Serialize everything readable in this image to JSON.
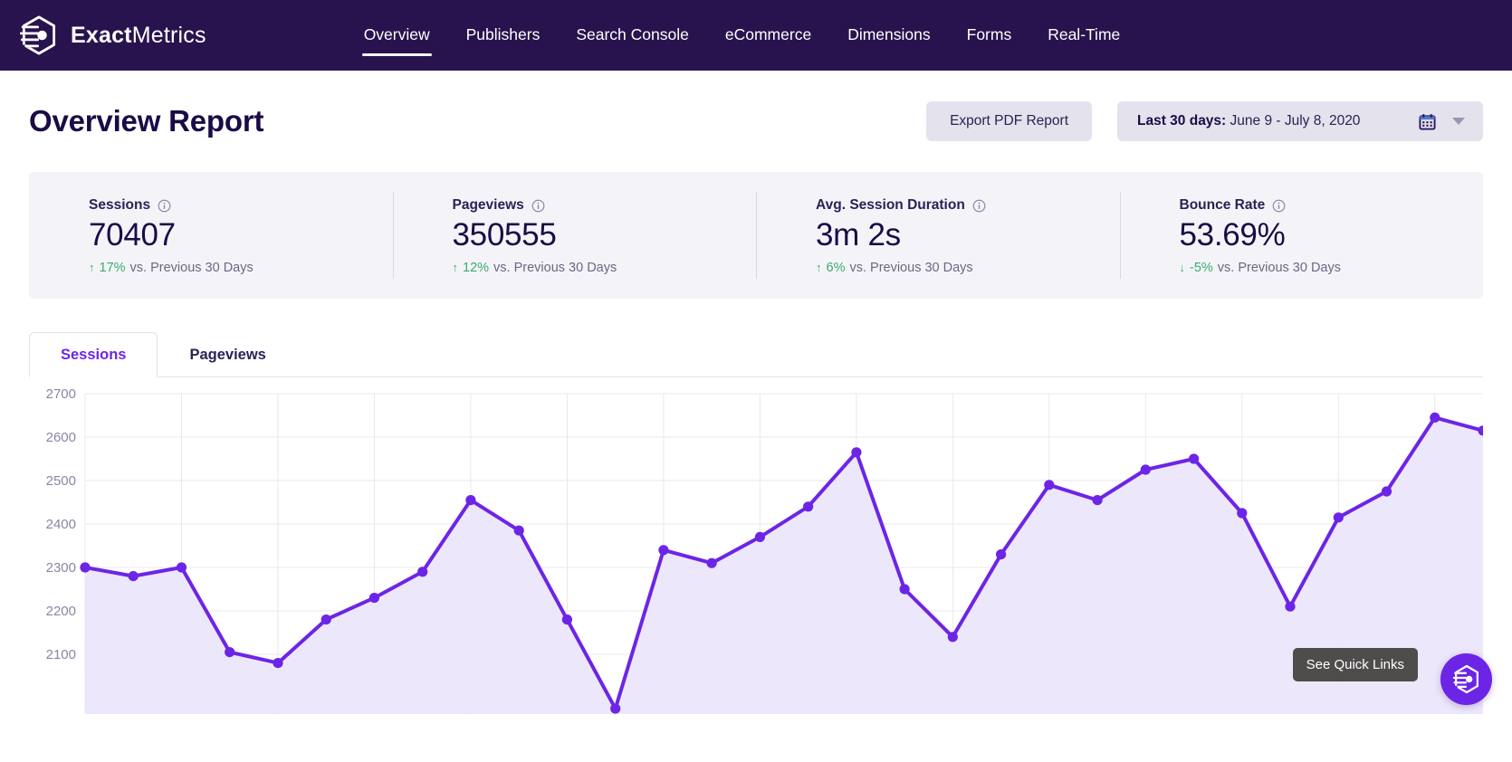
{
  "brand": {
    "bold": "Exact",
    "regular": "Metrics",
    "logo_icon": "exactmetrics-hexagon-logo"
  },
  "nav": {
    "items": [
      {
        "label": "Overview",
        "active": true
      },
      {
        "label": "Publishers",
        "active": false
      },
      {
        "label": "Search Console",
        "active": false
      },
      {
        "label": "eCommerce",
        "active": false
      },
      {
        "label": "Dimensions",
        "active": false
      },
      {
        "label": "Forms",
        "active": false
      },
      {
        "label": "Real-Time",
        "active": false
      }
    ]
  },
  "header": {
    "title": "Overview Report",
    "export_label": "Export PDF Report",
    "date_range_prefix": "Last 30 days:",
    "date_range_value": "June 9 - July 8, 2020",
    "calendar_icon": "calendar-icon",
    "caret_icon": "chevron-down-icon"
  },
  "stats": [
    {
      "label": "Sessions",
      "value": "70407",
      "delta_arrow": "↑",
      "delta": "17%",
      "note": "vs. Previous 30 Days",
      "direction": "up",
      "color": "#3aab72"
    },
    {
      "label": "Pageviews",
      "value": "350555",
      "delta_arrow": "↑",
      "delta": "12%",
      "note": "vs. Previous 30 Days",
      "direction": "up",
      "color": "#3aab72"
    },
    {
      "label": "Avg. Session Duration",
      "value": "3m 2s",
      "delta_arrow": "↑",
      "delta": "6%",
      "note": "vs. Previous 30 Days",
      "direction": "up",
      "color": "#3aab72"
    },
    {
      "label": "Bounce Rate",
      "value": "53.69%",
      "delta_arrow": "↓",
      "delta": "-5%",
      "note": "vs. Previous 30 Days",
      "direction": "down",
      "color": "#3aab72"
    }
  ],
  "tabs": [
    {
      "label": "Sessions",
      "active": true
    },
    {
      "label": "Pageviews",
      "active": false
    }
  ],
  "overlay": {
    "quick_links_tooltip": "See Quick Links",
    "fab_icon": "exactmetrics-hexagon-logo"
  },
  "colors": {
    "brand_dark": "#29134e",
    "accent_purple": "#6c25e6",
    "area_fill": "#ece6fb",
    "stat_strip": "#f4f4f8",
    "positive": "#3aab72"
  },
  "chart_data": {
    "type": "line",
    "title": "Sessions",
    "xlabel": "",
    "ylabel": "",
    "ylim": [
      2050,
      2700
    ],
    "yticks": [
      2100,
      2200,
      2300,
      2400,
      2500,
      2600,
      2700
    ],
    "grid": true,
    "legend": "none",
    "area_filled": true,
    "x": [
      1,
      2,
      3,
      4,
      5,
      6,
      7,
      8,
      9,
      10,
      11,
      12,
      13,
      14,
      15,
      16,
      17,
      18,
      19,
      20,
      21,
      22,
      23,
      24,
      25,
      26,
      27,
      28,
      29,
      30
    ],
    "values": [
      2300,
      2280,
      2300,
      2105,
      2080,
      2180,
      2230,
      2290,
      2455,
      2385,
      2180,
      1975,
      2340,
      2310,
      2370,
      2440,
      2565,
      2250,
      2140,
      2330,
      2490,
      2455,
      2525,
      2550,
      2425,
      2210,
      2415,
      2475,
      2645,
      2615
    ],
    "series": [
      {
        "name": "Sessions",
        "color": "#6c25e6"
      }
    ]
  }
}
